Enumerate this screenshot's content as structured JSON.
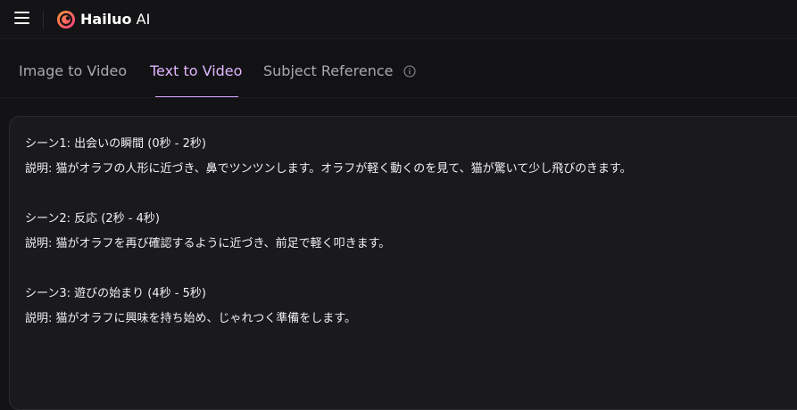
{
  "header": {
    "brand_bold": "Hailuo",
    "brand_light": " AI",
    "icons": [
      "menu-icon",
      "hailuo-logo-icon"
    ],
    "colors": {
      "background": "#141416",
      "logo_gradient": [
        "#ff4d6d",
        "#ff9a3c"
      ]
    }
  },
  "tabs": {
    "items": [
      {
        "label": "Image to Video",
        "active": false
      },
      {
        "label": "Text to Video",
        "active": true
      },
      {
        "label": "Subject Reference",
        "active": false
      }
    ],
    "active_color": "#e0b5ff",
    "info_icon": "info-circle-icon"
  },
  "prompt": {
    "lines": [
      "シーン1: 出会いの瞬間 (0秒 - 2秒)",
      "説明: 猫がオラフの人形に近づき、鼻でツンツンします。オラフが軽く動くのを見て、猫が驚いて少し飛びのきます。",
      "シーン2: 反応 (2秒 - 4秒)",
      "説明: 猫がオラフを再び確認するように近づき、前足で軽く叩きます。",
      "シーン3: 遊びの始まり (4秒 - 5秒)",
      "説明: 猫がオラフに興味を持ち始め、じゃれつく準備をします。"
    ]
  }
}
